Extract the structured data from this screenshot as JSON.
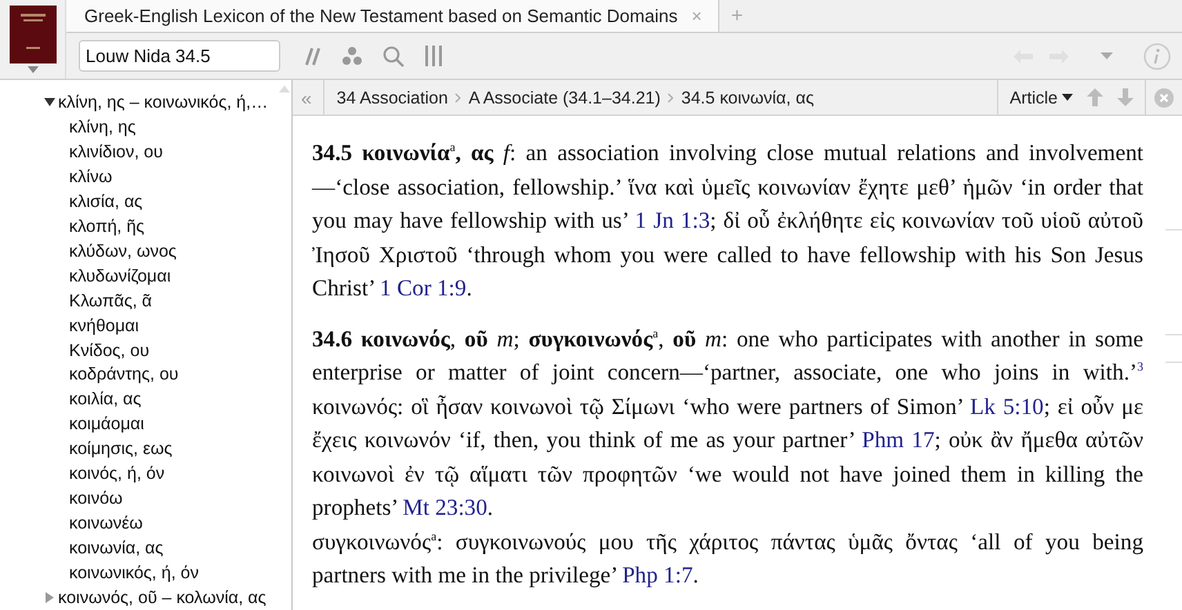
{
  "tab": {
    "title": "Greek-English Lexicon of the New Testament based on Semantic Domains",
    "close": "×"
  },
  "new_tab": "+",
  "search": {
    "value": "Louw Nida 34.5"
  },
  "sidebar": {
    "tree": [
      {
        "label": "κλίνη, ης – κοινωνικός, ή,…",
        "expanded": true,
        "children": [
          {
            "label": "κλίνη, ης"
          },
          {
            "label": "κλινίδιον, ου"
          },
          {
            "label": "κλίνω"
          },
          {
            "label": "κλισία, ας"
          },
          {
            "label": "κλοπή, ῆς"
          },
          {
            "label": "κλύδων, ωνος"
          },
          {
            "label": "κλυδωνίζομαι"
          },
          {
            "label": "Κλωπᾶς, ᾶ"
          },
          {
            "label": "κνήθομαι"
          },
          {
            "label": "Κνίδος, ου"
          },
          {
            "label": "κοδράντης, ου"
          },
          {
            "label": "κοιλία, ας"
          },
          {
            "label": "κοιμάομαι"
          },
          {
            "label": "κοίμησις, εως"
          },
          {
            "label": "κοινός, ή, όν"
          },
          {
            "label": "κοινόω"
          },
          {
            "label": "κοινωνέω"
          },
          {
            "label": "κοινωνία, ας"
          },
          {
            "label": "κοινωνικός, ή, όν"
          }
        ]
      },
      {
        "label": "κοινωνός, οῦ – κολωνία, ας",
        "expanded": false
      }
    ]
  },
  "breadcrumb": {
    "collapse": "«",
    "items": [
      "34 Association",
      "A Associate (34.1–34.21)",
      "34.5 κοινωνία, ας"
    ],
    "view": "Article"
  },
  "article": {
    "entries": [
      {
        "paragraphs": [
          [
            {
              "kind": "text",
              "text": "**34.5 κοινωνία**$^{a}$**, ας** *f*: an association involving close mutual relations and involvement—‘close association, fellowship.’ ἵνα καὶ ὑμεῖς κοινωνίαν ἔχητε μεθ’ ἡμῶν ‘in order that you may have fellowship with us’ "
            },
            {
              "kind": "ref",
              "text": "1 Jn 1:3"
            },
            {
              "kind": "text",
              "text": "; δἰ οὗ ἐκλήθητε εἰς κοινωνίαν τοῦ υἱοῦ αὐτοῦ Ἰησοῦ Χριστοῦ ‘through whom you were called to have fellowship with his Son Jesus Christ’ "
            },
            {
              "kind": "ref",
              "text": "1 Cor 1:9"
            },
            {
              "kind": "text",
              "text": "."
            }
          ]
        ]
      },
      {
        "paragraphs": [
          [
            {
              "kind": "text",
              "text": "**34.6 κοινωνός**, **οῦ** *m*; **συγκοινωνός**$^{a}$, **οῦ** *m*: one who participates with another in some enterprise or matter of joint concern—‘partner, associate, one who joins in with.’"
            },
            {
              "kind": "note",
              "text": "3"
            },
            {
              "kind": "text",
              "text": " κοινωνός: οἳ ἦσαν κοινωνοὶ τῷ Σίμωνι ‘who were partners of Simon’ "
            },
            {
              "kind": "ref",
              "text": "Lk 5:10"
            },
            {
              "kind": "text",
              "text": "; εἰ οὖν με ἔχεις κοινωνόν ‘if, then, you think of me as your partner’ "
            },
            {
              "kind": "ref",
              "text": "Phm 17"
            },
            {
              "kind": "text",
              "text": "; οὐκ ἂν ἤμεθα αὐτῶν κοινωνοὶ ἐν τῷ αἵματι τῶν προφητῶν ‘we would not have joined them in killing the prophets’ "
            },
            {
              "kind": "ref",
              "text": "Mt 23:30"
            },
            {
              "kind": "text",
              "text": "."
            }
          ],
          [
            {
              "kind": "text",
              "text": "συγκοινωνός$^{a}$: συγκοινωνούς μου τῆς χάριτος πάντας ὑμᾶς ὄντας ‘all of you being partners with me in the privilege’ "
            },
            {
              "kind": "ref",
              "text": "Php 1:7"
            },
            {
              "kind": "text",
              "text": "."
            }
          ]
        ]
      }
    ]
  }
}
